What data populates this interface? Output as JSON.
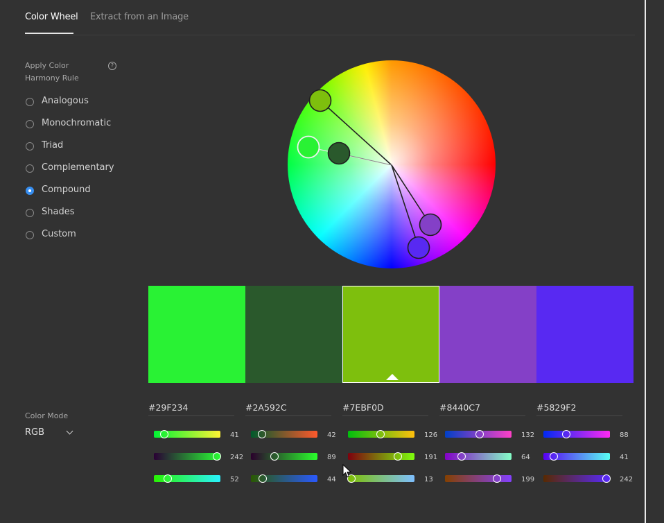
{
  "tabs": [
    {
      "label": "Color Wheel",
      "active": true
    },
    {
      "label": "Extract from an Image",
      "active": false
    }
  ],
  "harmony": {
    "title": "Apply Color Harmony Rule",
    "help_icon": "?",
    "rules": [
      {
        "label": "Analogous",
        "checked": false
      },
      {
        "label": "Monochromatic",
        "checked": false
      },
      {
        "label": "Triad",
        "checked": false
      },
      {
        "label": "Complementary",
        "checked": false
      },
      {
        "label": "Compound",
        "checked": true
      },
      {
        "label": "Shades",
        "checked": false
      },
      {
        "label": "Custom",
        "checked": false
      }
    ]
  },
  "colors": [
    {
      "hex": "#29F234",
      "rgb": [
        41,
        242,
        52
      ],
      "selected": false
    },
    {
      "hex": "#2A592C",
      "rgb": [
        42,
        89,
        44
      ],
      "selected": false
    },
    {
      "hex": "#7EBF0D",
      "rgb": [
        126,
        191,
        13
      ],
      "selected": true
    },
    {
      "hex": "#8440C7",
      "rgb": [
        132,
        64,
        199
      ],
      "selected": false
    },
    {
      "hex": "#5829F2",
      "rgb": [
        88,
        41,
        242
      ],
      "selected": false
    }
  ],
  "color_mode": {
    "label": "Color Mode",
    "value": "RGB"
  },
  "accent": "#378ef0",
  "background": "#323232"
}
